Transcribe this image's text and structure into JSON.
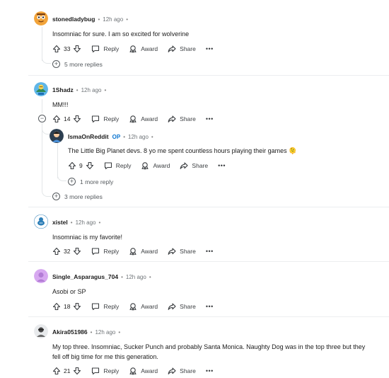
{
  "labels": {
    "reply": "Reply",
    "award": "Award",
    "share": "Share",
    "more": "•••",
    "op": "OP",
    "dot": "•"
  },
  "comments": [
    {
      "user": "stonedladybug",
      "time": "12h ago",
      "text": "Insomniac for sure. I am so excited for wolverine",
      "votes": "33",
      "more_replies": "5 more replies"
    },
    {
      "user": "1Shadz",
      "time": "12h ago",
      "text": "MM!!!",
      "votes": "14",
      "more_replies": "3 more replies",
      "reply": {
        "user": "IsmaOnReddit",
        "time": "12h ago",
        "text": "The Little Big Planet devs. 8 yo me spent countless hours playing their games 🫠",
        "votes": "9",
        "more_replies": "1 more reply"
      }
    },
    {
      "user": "xistel",
      "time": "12h ago",
      "text": "Insomniac is my favorite!",
      "votes": "32"
    },
    {
      "user": "Single_Asparagus_704",
      "time": "12h ago",
      "text": "Asobi or SP",
      "votes": "18"
    },
    {
      "user": "Akira051986",
      "time": "12h ago",
      "text_line1": "My top three. Insomniac, Sucker Punch and probably Santa Monica. Naughty Dog was in the top three but they",
      "text_line2": "fell off big time for me this generation.",
      "votes": "21"
    }
  ],
  "colors": {
    "op_badge": "#0a74d0",
    "thread_line": "#e3e6e8",
    "meta_text": "#6f7478"
  },
  "icons": [
    "upvote-icon",
    "downvote-icon",
    "reply-icon",
    "award-icon",
    "share-icon",
    "plus-circle-icon",
    "minus-circle-icon"
  ]
}
